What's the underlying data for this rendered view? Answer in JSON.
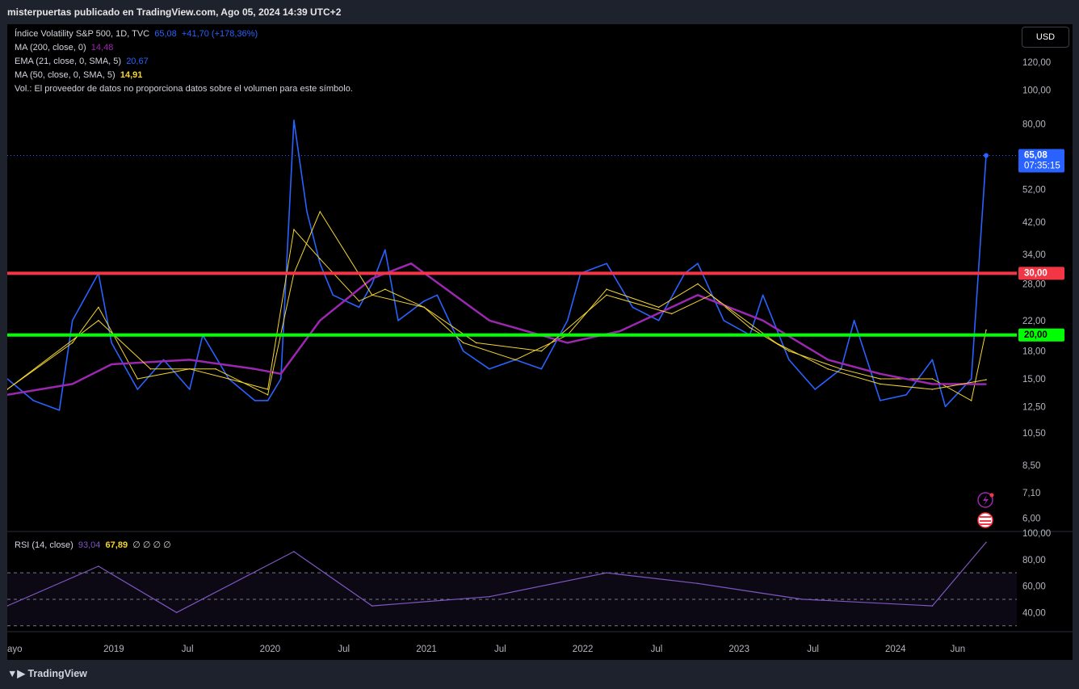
{
  "header": {
    "publisher": "misterpuertas publicado en TradingView.com, Ago 05, 2024 14:39 UTC+2"
  },
  "currency_button": "USD",
  "legend": {
    "main_name": "Índice Volatility S&P 500, 1D, TVC",
    "main_value": "65,08",
    "main_change": "+41,70 (+178,36%)",
    "ma200_name": "MA (200, close, 0)",
    "ma200_value": "14,48",
    "ema21_name": "EMA (21, close, 0, SMA, 5)",
    "ema21_value": "20,67",
    "ma50_name": "MA (50, close, 0, SMA, 5)",
    "ma50_value": "14,91",
    "volume_note": "Vol.: El proveedor de datos no proporciona datos sobre el volumen para este símbolo."
  },
  "rsi_legend": {
    "name": "RSI (14, close)",
    "rsi_value": "93,04",
    "ma_value": "67,89",
    "extras": "∅ ∅ ∅ ∅"
  },
  "price_axis_labels": [
    "120,00",
    "100,00",
    "80,00",
    "52,00",
    "42,00",
    "34,00",
    "28,00",
    "22,00",
    "18,00",
    "15,00",
    "12,50",
    "10,50",
    "8,50",
    "7,10",
    "6,00"
  ],
  "rsi_axis_labels": [
    "100,00",
    "80,00",
    "60,00",
    "40,00"
  ],
  "time_axis_labels": [
    "ayo",
    "2019",
    "Jul",
    "2020",
    "Jul",
    "2021",
    "Jul",
    "2022",
    "Jul",
    "2023",
    "Jul",
    "2024",
    "Jun"
  ],
  "last_price": {
    "value": "65,08",
    "countdown": "07:35:15"
  },
  "level_labels": {
    "red": "30,00",
    "green": "20,00"
  },
  "footer": {
    "brand": "TradingView"
  },
  "colors": {
    "price": "#2962ff",
    "ma200": "#9c27b0",
    "ma50": "#f5d52f",
    "red_line": "#f23645",
    "green_line": "#00ff00",
    "rsi": "#7e57c2"
  },
  "chart_data": {
    "type": "line",
    "title": "Índice Volatility S&P 500, 1D, TVC",
    "x_range": [
      "2018-05",
      "2024-08-05"
    ],
    "y_scale": "log",
    "ylim": [
      5.5,
      135
    ],
    "horizontal_levels": [
      30,
      20
    ],
    "series": [
      {
        "name": "Índice Volatility S&P 500",
        "x": [
          "2018-05",
          "2018-07",
          "2018-09",
          "2018-10",
          "2018-12",
          "2019-01",
          "2019-03",
          "2019-05",
          "2019-07",
          "2019-08",
          "2019-10",
          "2019-12",
          "2020-01",
          "2020-02",
          "2020-03",
          "2020-04",
          "2020-05",
          "2020-06",
          "2020-08",
          "2020-09",
          "2020-10",
          "2020-11",
          "2021-01",
          "2021-02",
          "2021-04",
          "2021-06",
          "2021-08",
          "2021-10",
          "2021-12",
          "2022-01",
          "2022-03",
          "2022-05",
          "2022-07",
          "2022-09",
          "2022-10",
          "2022-12",
          "2023-02",
          "2023-03",
          "2023-05",
          "2023-07",
          "2023-09",
          "2023-10",
          "2023-12",
          "2024-02",
          "2024-04",
          "2024-05",
          "2024-07",
          "2024-08-05"
        ],
        "values": [
          15,
          13,
          12.2,
          22,
          30,
          19,
          14,
          17,
          14,
          20,
          15,
          13,
          13,
          15,
          82,
          45,
          32,
          26,
          24,
          28,
          35,
          22,
          25,
          26,
          18,
          16,
          17,
          16,
          22,
          30,
          32,
          24,
          22,
          30,
          32,
          22,
          20,
          26,
          17,
          14,
          16,
          22,
          13,
          13.5,
          17,
          12.5,
          15,
          65.08
        ]
      },
      {
        "name": "EMA (21, close, 0, SMA, 5)",
        "x": [
          "2018-05",
          "2018-10",
          "2018-12",
          "2019-03",
          "2019-07",
          "2019-10",
          "2020-01",
          "2020-03",
          "2020-05",
          "2020-08",
          "2020-10",
          "2021-01",
          "2021-04",
          "2021-08",
          "2021-12",
          "2022-03",
          "2022-07",
          "2022-10",
          "2023-02",
          "2023-05",
          "2023-09",
          "2023-12",
          "2024-04",
          "2024-07",
          "2024-08-05"
        ],
        "values": [
          14,
          19,
          24,
          15,
          16,
          15,
          14,
          40,
          33,
          25,
          27,
          24,
          19,
          17,
          20,
          27,
          24,
          28,
          21,
          18,
          16,
          15,
          15,
          13,
          20.67
        ]
      },
      {
        "name": "MA (200, close, 0)",
        "x": [
          "2018-05",
          "2018-10",
          "2019-01",
          "2019-07",
          "2019-12",
          "2020-02",
          "2020-05",
          "2020-09",
          "2020-12",
          "2021-06",
          "2021-12",
          "2022-04",
          "2022-10",
          "2023-03",
          "2023-08",
          "2023-12",
          "2024-04",
          "2024-08-05"
        ],
        "values": [
          13.5,
          14.5,
          16.5,
          17,
          16,
          15.5,
          22,
          29,
          32,
          22,
          19,
          20.5,
          26,
          22,
          17,
          15.5,
          14.5,
          14.48
        ]
      },
      {
        "name": "MA (50, close, 0, SMA, 5)",
        "x": [
          "2018-05",
          "2018-12",
          "2019-04",
          "2019-09",
          "2020-01",
          "2020-03",
          "2020-05",
          "2020-09",
          "2021-01",
          "2021-05",
          "2021-10",
          "2022-03",
          "2022-08",
          "2022-11",
          "2023-04",
          "2023-08",
          "2023-12",
          "2024-04",
          "2024-08-05"
        ],
        "values": [
          14,
          22,
          16,
          16,
          13.5,
          30,
          45,
          26,
          24,
          19,
          18,
          26,
          23,
          26,
          19,
          16,
          14.5,
          14,
          14.91
        ]
      },
      {
        "name": "RSI (14, close)",
        "x": [
          "2018-05",
          "2018-12",
          "2019-06",
          "2020-03",
          "2020-09",
          "2021-06",
          "2022-03",
          "2022-10",
          "2023-06",
          "2024-04",
          "2024-08-05"
        ],
        "values": [
          45,
          75,
          40,
          86,
          45,
          52,
          70,
          62,
          50,
          45,
          93.04
        ]
      }
    ]
  }
}
